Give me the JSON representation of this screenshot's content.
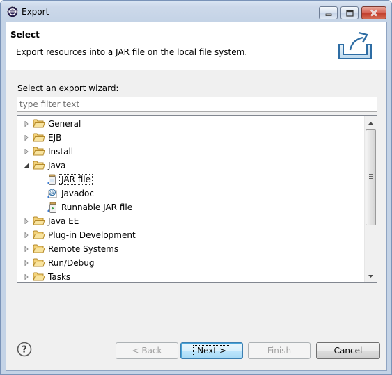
{
  "window": {
    "title": "Export"
  },
  "header": {
    "title": "Select",
    "description": "Export resources into a JAR file on the local file system."
  },
  "wizard_label": "Select an export wizard:",
  "filter": {
    "placeholder": "type filter text",
    "value": ""
  },
  "tree": {
    "items": [
      {
        "label": "General",
        "type": "folder",
        "expanded": false,
        "level": 0
      },
      {
        "label": "EJB",
        "type": "folder",
        "expanded": false,
        "level": 0
      },
      {
        "label": "Install",
        "type": "folder",
        "expanded": false,
        "level": 0
      },
      {
        "label": "Java",
        "type": "folder",
        "expanded": true,
        "level": 0
      },
      {
        "label": "JAR file",
        "type": "jar",
        "level": 1,
        "selected": true
      },
      {
        "label": "Javadoc",
        "type": "javadoc",
        "level": 1
      },
      {
        "label": "Runnable JAR file",
        "type": "runnable-jar",
        "level": 1
      },
      {
        "label": "Java EE",
        "type": "folder",
        "expanded": false,
        "level": 0
      },
      {
        "label": "Plug-in Development",
        "type": "folder",
        "expanded": false,
        "level": 0
      },
      {
        "label": "Remote Systems",
        "type": "folder",
        "expanded": false,
        "level": 0
      },
      {
        "label": "Run/Debug",
        "type": "folder",
        "expanded": false,
        "level": 0
      },
      {
        "label": "Tasks",
        "type": "folder",
        "expanded": false,
        "level": 0
      }
    ]
  },
  "buttons": {
    "back": "< Back",
    "next": "Next >",
    "finish": "Finish",
    "cancel": "Cancel"
  },
  "icons": {
    "app": "eclipse-icon",
    "header_image": "export-wizard-icon",
    "help": "help-icon",
    "folder": "folder-icon"
  },
  "colors": {
    "folder": "#e8b84a",
    "selection_border": "#333333",
    "default_button": "#3c7fb1"
  }
}
